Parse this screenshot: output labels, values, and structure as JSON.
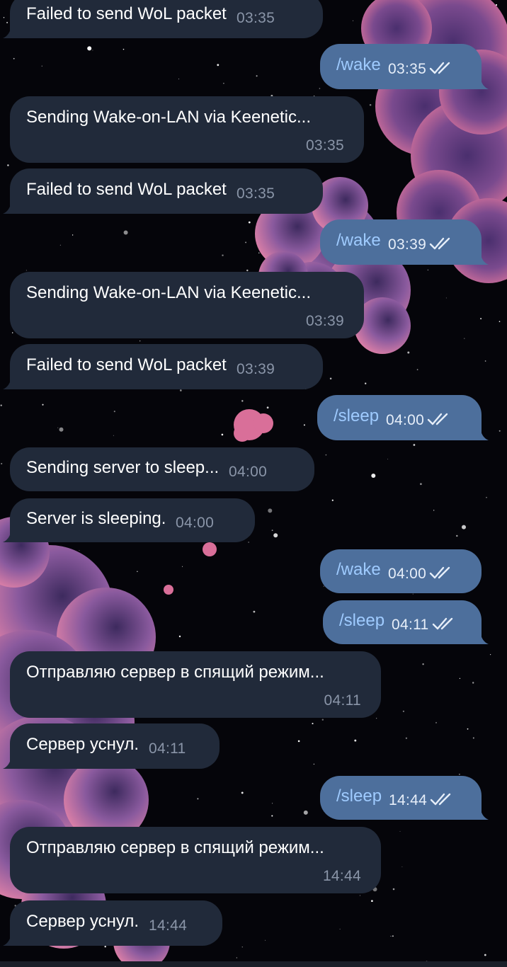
{
  "chat": {
    "messages": [
      {
        "dir": "in",
        "text": "Failed to send WoL packet",
        "time": "03:35"
      },
      {
        "dir": "out",
        "text": "/wake",
        "time": "03:35",
        "status": "read"
      },
      {
        "dir": "in",
        "text": "Sending Wake-on-LAN via Keenetic...",
        "time": "03:35"
      },
      {
        "dir": "in",
        "text": "Failed to send WoL packet",
        "time": "03:35"
      },
      {
        "dir": "out",
        "text": "/wake",
        "time": "03:39",
        "status": "read"
      },
      {
        "dir": "in",
        "text": "Sending Wake-on-LAN via Keenetic...",
        "time": "03:39"
      },
      {
        "dir": "in",
        "text": "Failed to send WoL packet",
        "time": "03:39"
      },
      {
        "dir": "out",
        "text": "/sleep",
        "time": "04:00",
        "status": "read"
      },
      {
        "dir": "in",
        "text": "Sending server to sleep...",
        "time": "04:00"
      },
      {
        "dir": "in",
        "text": "Server is sleeping.",
        "time": "04:00"
      },
      {
        "dir": "out",
        "text": "/wake",
        "time": "04:00",
        "status": "read"
      },
      {
        "dir": "out",
        "text": "/sleep",
        "time": "04:11",
        "status": "read"
      },
      {
        "dir": "in",
        "text": "Отправляю сервер в спящий режим...",
        "time": "04:11"
      },
      {
        "dir": "in",
        "text": "Сервер уснул.",
        "time": "04:11"
      },
      {
        "dir": "out",
        "text": "/sleep",
        "time": "14:44",
        "status": "read"
      },
      {
        "dir": "in",
        "text": "Отправляю сервер в спящий режим...",
        "time": "14:44"
      },
      {
        "dir": "in",
        "text": "Сервер уснул.",
        "time": "14:44"
      }
    ]
  },
  "colors": {
    "incoming_bubble": "#212a3a",
    "outgoing_bubble": "#4d6f9c",
    "command_text": "#9fcbff",
    "background": "#05050a",
    "cloud_pink": "#e2779d",
    "cloud_purple": "#5a3a7a"
  },
  "icons": {
    "read_status": "double-check-icon"
  }
}
